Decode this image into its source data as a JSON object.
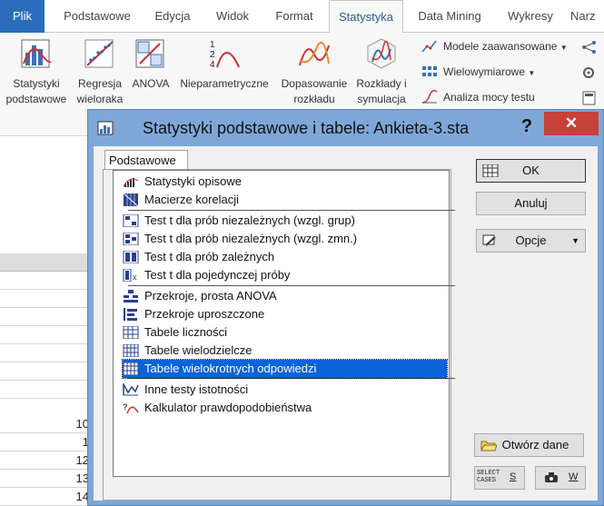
{
  "ribbon": {
    "tabs": [
      {
        "label": "Plik"
      },
      {
        "label": "Podstawowe"
      },
      {
        "label": "Edycja"
      },
      {
        "label": "Widok"
      },
      {
        "label": "Format"
      },
      {
        "label": "Statystyka"
      },
      {
        "label": "Data Mining"
      },
      {
        "label": "Wykresy"
      },
      {
        "label": "Narz"
      }
    ],
    "buttons": [
      {
        "line1": "Statystyki",
        "line2": "podstawowe"
      },
      {
        "line1": "Regresja",
        "line2": "wieloraka"
      },
      {
        "line1": "ANOVA",
        "line2": ""
      },
      {
        "line1": "Nieparametryczne",
        "line2": ""
      },
      {
        "line1": "Dopasowanie",
        "line2": "rozkładu"
      },
      {
        "line1": "Rozkłady i",
        "line2": "symulacja"
      }
    ],
    "small": [
      {
        "label": "Modele zaawansowane"
      },
      {
        "label": "Wielowymiarowe"
      },
      {
        "label": "Analiza mocy testu"
      }
    ]
  },
  "sheet": {
    "rows": [
      "",
      "",
      "",
      "",
      "",
      "",
      "",
      "10",
      "1",
      "12",
      "13",
      "14"
    ]
  },
  "dialog": {
    "title": "Statystyki podstawowe i tabele: Ankieta-3.sta",
    "help": "?",
    "close": "✕",
    "tab": "Podstawowe",
    "items": [
      {
        "label": "Statystyki opisowe",
        "icon": "descriptive-stats-icon"
      },
      {
        "label": "Macierze korelacji",
        "icon": "correlation-matrix-icon"
      },
      {
        "label": "Test t dla prób niezależnych (wzgl. grup)",
        "icon": "t-test-groups-icon"
      },
      {
        "label": "Test t dla prób niezależnych (wzgl. zmn.)",
        "icon": "t-test-variables-icon"
      },
      {
        "label": "Test t dla prób zależnych",
        "icon": "t-test-dependent-icon"
      },
      {
        "label": "Test t dla pojedynczej próby",
        "icon": "t-test-single-icon"
      },
      {
        "label": "Przekroje, prosta ANOVA",
        "icon": "breakdown-icon"
      },
      {
        "label": "Przekroje uproszczone",
        "icon": "breakdown-simple-icon"
      },
      {
        "label": "Tabele liczności",
        "icon": "frequency-table-icon"
      },
      {
        "label": "Tabele wielodzielcze",
        "icon": "crosstab-icon"
      },
      {
        "label": "Tabele wielokrotnych odpowiedzi",
        "icon": "multiple-response-icon"
      },
      {
        "label": "Inne testy istotności",
        "icon": "significance-tests-icon"
      },
      {
        "label": "Kalkulator prawdopodobieństwa",
        "icon": "probability-calculator-icon"
      }
    ],
    "selected_index": 10,
    "buttons": {
      "ok": "OK",
      "cancel": "Anuluj",
      "options": "Opcje",
      "open_data": "Otwórz dane",
      "select_cases_line1": "SELECT",
      "select_cases_line2": "CASES",
      "select_cases_key": "S",
      "weight_key": "W"
    }
  }
}
